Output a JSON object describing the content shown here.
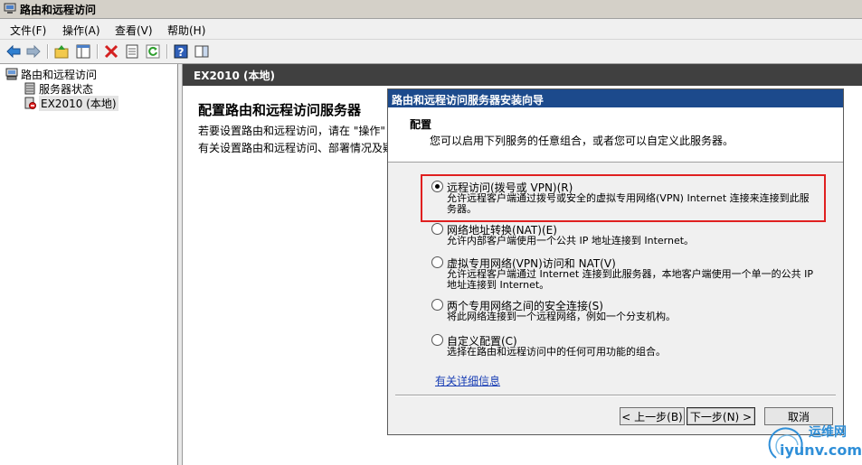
{
  "window": {
    "title": "路由和远程访问"
  },
  "menu": {
    "items": [
      "文件(F)",
      "操作(A)",
      "查看(V)",
      "帮助(H)"
    ]
  },
  "tree": {
    "root": "路由和远程访问",
    "children": [
      "服务器状态",
      "EX2010 (本地)"
    ]
  },
  "rightpane": {
    "header": "EX2010 (本地)",
    "title": "配置路由和远程访问服务器",
    "line1": "若要设置路由和远程访问，请在 \"操作\"",
    "line2": "有关设置路由和远程访问、部署情况及疑"
  },
  "wizard": {
    "title": "路由和远程访问服务器安装向导",
    "heading": "配置",
    "subheading": "您可以启用下列服务的任意组合，或者您可以自定义此服务器。",
    "options": [
      {
        "label": "远程访问(拨号或 VPN)(R)",
        "desc": "允许远程客户端通过拨号或安全的虚拟专用网络(VPN) Internet 连接来连接到此服务器。",
        "checked": true
      },
      {
        "label": "网络地址转换(NAT)(E)",
        "desc": "允许内部客户端使用一个公共 IP 地址连接到 Internet。",
        "checked": false
      },
      {
        "label": "虚拟专用网络(VPN)访问和 NAT(V)",
        "desc": "允许远程客户端通过 Internet 连接到此服务器，本地客户端使用一个单一的公共 IP 地址连接到 Internet。",
        "checked": false
      },
      {
        "label": "两个专用网络之间的安全连接(S)",
        "desc": "将此网络连接到一个远程网络，例如一个分支机构。",
        "checked": false
      },
      {
        "label": "自定义配置(C)",
        "desc": "选择在路由和远程访问中的任何可用功能的组合。",
        "checked": false
      }
    ],
    "details_link": "有关详细信息",
    "buttons": {
      "back": "< 上一步(B)",
      "next": "下一步(N) >",
      "cancel": "取消"
    }
  },
  "watermark": {
    "brand": "运维网",
    "domain": "iyunv.com"
  },
  "colors": {
    "wizard_title_bg": "#1c4a8c",
    "highlight": "#e02020",
    "link": "#1a3fb5",
    "pane_header": "#404040"
  }
}
